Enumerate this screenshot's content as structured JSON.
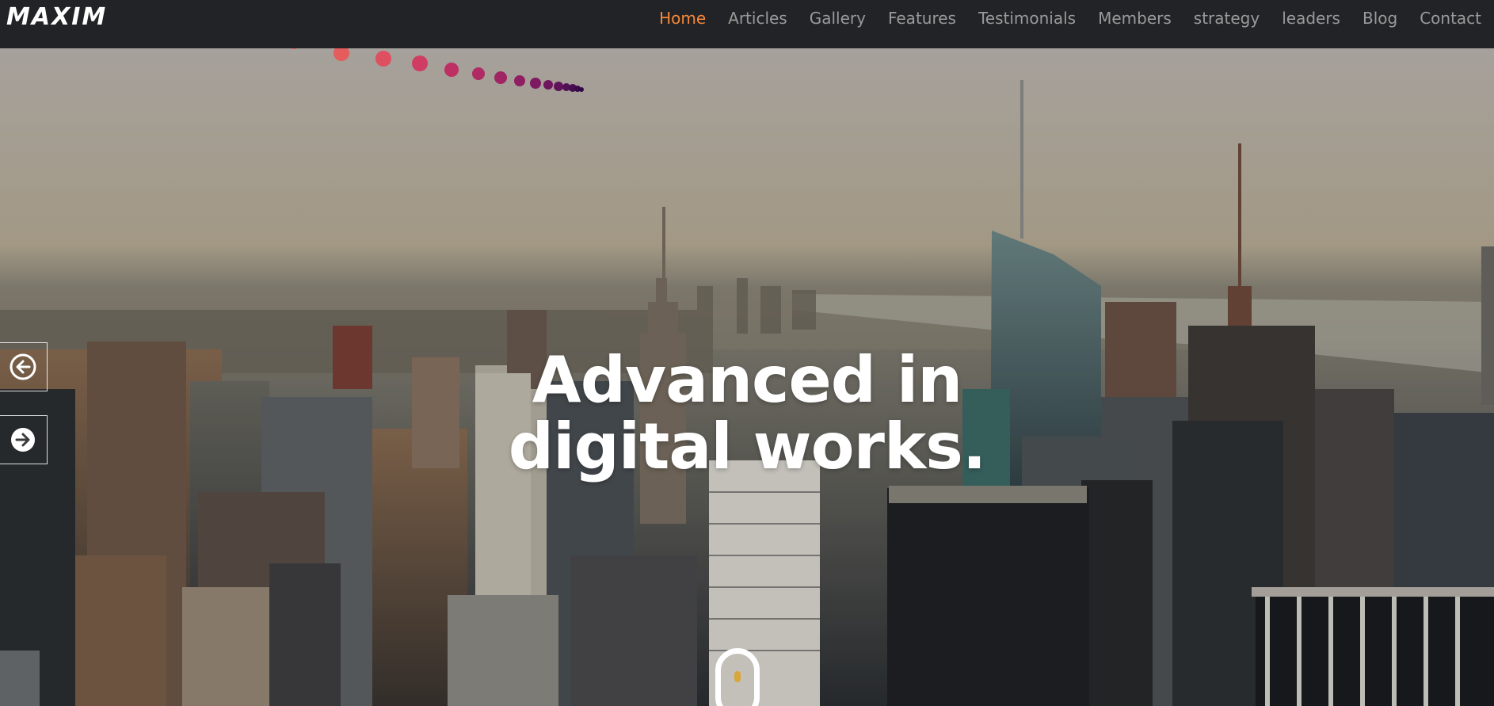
{
  "brand": {
    "logo_text": "MAXIM"
  },
  "nav": {
    "items": [
      {
        "label": "Home",
        "active": true
      },
      {
        "label": "Articles",
        "active": false
      },
      {
        "label": "Gallery",
        "active": false
      },
      {
        "label": "Features",
        "active": false
      },
      {
        "label": "Testimonials",
        "active": false
      },
      {
        "label": "Members",
        "active": false
      },
      {
        "label": "strategy",
        "active": false
      },
      {
        "label": "leaders",
        "active": false
      },
      {
        "label": "Blog",
        "active": false
      },
      {
        "label": "Contact",
        "active": false
      }
    ]
  },
  "hero": {
    "headline_line1": "Advanced in",
    "headline_line2": "digital works.",
    "prev_icon": "arrow-left-circle-icon",
    "next_icon": "arrow-right-circle-icon",
    "scroll_icon": "mouse-scroll-icon"
  },
  "colors": {
    "navbar_bg": "#222326",
    "nav_text": "#9a9a9a",
    "nav_active": "#f5873a",
    "headline": "#ffffff"
  }
}
